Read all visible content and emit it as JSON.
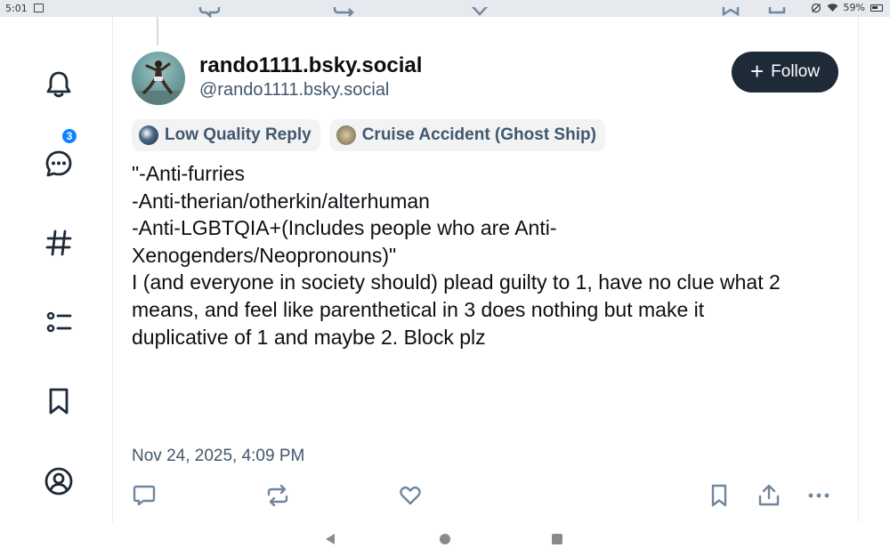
{
  "status_bar": {
    "time": "5:01",
    "battery": "59%"
  },
  "nav": {
    "items": [
      {
        "name": "notifications",
        "icon": "bell-icon"
      },
      {
        "name": "chat",
        "icon": "chat-icon",
        "badge": "3"
      },
      {
        "name": "feeds",
        "icon": "hashtag-icon"
      },
      {
        "name": "lists",
        "icon": "list-icon"
      },
      {
        "name": "saved",
        "icon": "bookmark-icon"
      },
      {
        "name": "profile",
        "icon": "user-circle-icon"
      }
    ]
  },
  "post": {
    "display_name": "rando1111.bsky.social",
    "handle": "@rando1111.bsky.social",
    "follow_label": "Follow",
    "labels": [
      {
        "text": "Low Quality Reply"
      },
      {
        "text": "Cruise Accident (Ghost Ship)"
      }
    ],
    "body": [
      "\"-Anti-furries",
      "",
      "-Anti-therian/otherkin/alterhuman",
      "",
      "-Anti-LGBTQIA+(Includes people who are Anti-\nXenogenders/Neopronouns)\"",
      "",
      "I (and everyone in society should) plead guilty to 1, have no clue what 2\nmeans, and feel like parenthetical in 3 does nothing but make it\nduplicative of 1 and maybe 2. Block plz"
    ],
    "timestamp": "Nov 24, 2025, 4:09 PM"
  },
  "colors": {
    "accent": "#1083fe",
    "follow_bg": "#1e2a38",
    "muted_text": "#42576c",
    "icon": "#1e2a38"
  }
}
